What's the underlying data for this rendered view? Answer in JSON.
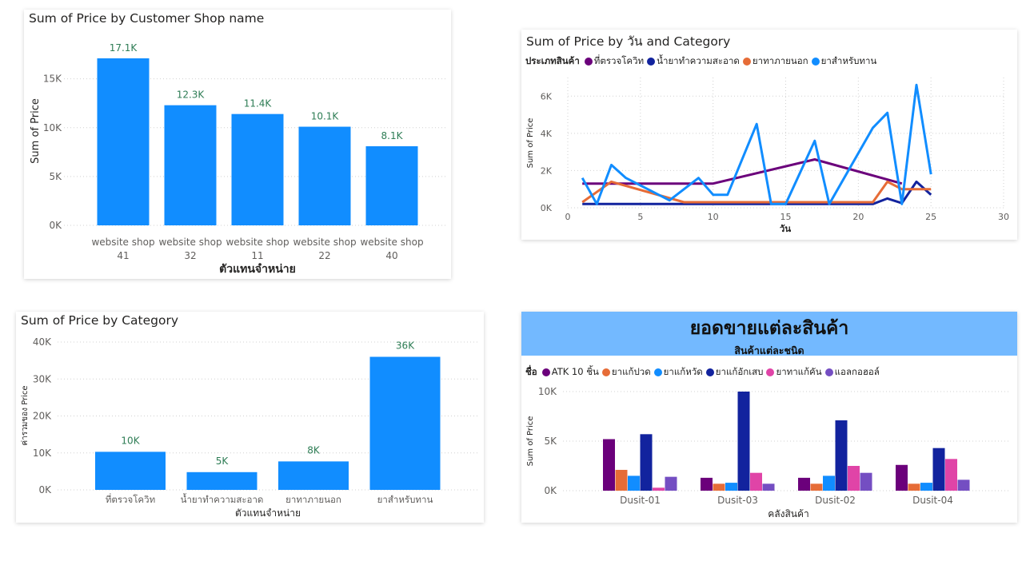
{
  "colors": {
    "bar": "#118dff",
    "label_green": "#2e7d55",
    "grid": "#d0d0d0",
    "axis_text": "#605e5c"
  },
  "charts": {
    "shop": {
      "title": "Sum of Price by Customer Shop name",
      "xlabel": "ตัวแทนจำหน่าย",
      "ylabel": "Sum of Price"
    },
    "day": {
      "title": "Sum of Price by วัน and Category",
      "legend_title": "ประเภทสินค้า",
      "xlabel": "วัน",
      "ylabel": "Sum of Price"
    },
    "category": {
      "title": "Sum of Price by Category",
      "xlabel": "ตัวแทนจำหน่าย",
      "ylabel": "ค่ารวมของ Price"
    },
    "warehouse": {
      "banner_title": "ยอดขายแต่ละสินค้า",
      "banner_subtitle": "สินค้าแต่ละชนิด",
      "legend_title": "ชื่อ",
      "xlabel": "คลังสินค้า",
      "ylabel": "Sum of Price"
    }
  },
  "chart_data": [
    {
      "type": "bar",
      "title": "Sum of Price by Customer Shop name",
      "xlabel": "ตัวแทนจำหน่าย",
      "ylabel": "Sum of Price",
      "categories": [
        [
          "website shop",
          "41"
        ],
        [
          "website shop",
          "32"
        ],
        [
          "website shop",
          "11"
        ],
        [
          "website shop",
          "22"
        ],
        [
          "website shop",
          "40"
        ]
      ],
      "values": [
        17100,
        12300,
        11400,
        10100,
        8100
      ],
      "data_labels": [
        "17.1K",
        "12.3K",
        "11.4K",
        "10.1K",
        "8.1K"
      ],
      "yticks": [
        0,
        5000,
        10000,
        15000
      ],
      "ytick_labels": [
        "0K",
        "5K",
        "10K",
        "15K"
      ],
      "ylim": [
        0,
        18000
      ],
      "grid": true
    },
    {
      "type": "line",
      "title": "Sum of Price by วัน and Category",
      "xlabel": "วัน",
      "ylabel": "Sum of Price",
      "xlim": [
        0,
        30
      ],
      "xticks": [
        0,
        5,
        10,
        15,
        20,
        25,
        30
      ],
      "ylim": [
        0,
        7000
      ],
      "yticks": [
        0,
        2000,
        4000,
        6000
      ],
      "ytick_labels": [
        "0K",
        "2K",
        "4K",
        "6K"
      ],
      "legend_position": "top-left",
      "grid": true,
      "series": [
        {
          "name": "ที่ตรวจโควิท",
          "color": "#6b007b",
          "points": [
            [
              1,
              1300
            ],
            [
              10,
              1300
            ],
            [
              17,
              2600
            ],
            [
              23,
              1300
            ]
          ]
        },
        {
          "name": "น้ำยาทำความสะอาด",
          "color": "#12239e",
          "points": [
            [
              1,
              200
            ],
            [
              21,
              200
            ],
            [
              22,
              500
            ],
            [
              23,
              250
            ],
            [
              24,
              1400
            ],
            [
              25,
              700
            ]
          ]
        },
        {
          "name": "ยาทาภายนอก",
          "color": "#e66c37",
          "points": [
            [
              1,
              300
            ],
            [
              3,
              1400
            ],
            [
              8,
              300
            ],
            [
              21,
              300
            ],
            [
              22,
              1400
            ],
            [
              23,
              1000
            ],
            [
              25,
              1000
            ]
          ]
        },
        {
          "name": "ยาสำหรับทาน",
          "color": "#118dff",
          "points": [
            [
              1,
              1600
            ],
            [
              2,
              200
            ],
            [
              3,
              2300
            ],
            [
              4,
              1600
            ],
            [
              7,
              400
            ],
            [
              9,
              1600
            ],
            [
              10,
              700
            ],
            [
              11,
              700
            ],
            [
              13,
              4500
            ],
            [
              14,
              200
            ],
            [
              15,
              200
            ],
            [
              17,
              3600
            ],
            [
              18,
              200
            ],
            [
              21,
              4300
            ],
            [
              22,
              5100
            ],
            [
              23,
              200
            ],
            [
              24,
              6600
            ],
            [
              25,
              1800
            ]
          ]
        }
      ]
    },
    {
      "type": "bar",
      "title": "Sum of Price by Category",
      "xlabel": "ตัวแทนจำหน่าย",
      "ylabel": "ค่ารวมของ Price",
      "categories": [
        "ที่ตรวจโควิท",
        "น้ำยาทำความสะอาด",
        "ยาทาภายนอก",
        "ยาสำหรับทาน"
      ],
      "values": [
        10300,
        4800,
        7700,
        36000
      ],
      "data_labels": [
        "10K",
        "5K",
        "8K",
        "36K"
      ],
      "yticks": [
        0,
        10000,
        20000,
        30000,
        40000
      ],
      "ytick_labels": [
        "0K",
        "10K",
        "20K",
        "30K",
        "40K"
      ],
      "ylim": [
        0,
        40000
      ],
      "grid": true
    },
    {
      "type": "bar",
      "title": "ยอดขายแต่ละสินค้า",
      "subtitle": "สินค้าแต่ละชนิด",
      "xlabel": "คลังสินค้า",
      "ylabel": "Sum of Price",
      "legend_title": "ชื่อ",
      "legend_position": "top-left",
      "categories": [
        "Dusit-01",
        "Dusit-03",
        "Dusit-02",
        "Dusit-04"
      ],
      "yticks": [
        0,
        5000,
        10000
      ],
      "ytick_labels": [
        "0K",
        "5K",
        "10K"
      ],
      "ylim": [
        0,
        10000
      ],
      "grid": true,
      "series": [
        {
          "name": "ATK 10 ชิ้น",
          "color": "#6b007b",
          "values": [
            5200,
            1300,
            1300,
            2600
          ]
        },
        {
          "name": "ยาแก้ปวด",
          "color": "#e66c37",
          "values": [
            2100,
            700,
            700,
            700
          ]
        },
        {
          "name": "ยาแก้หวัด",
          "color": "#118dff",
          "values": [
            1500,
            800,
            1500,
            800
          ]
        },
        {
          "name": "ยาแก้อักเสบ",
          "color": "#12239e",
          "values": [
            5700,
            10000,
            7100,
            4300
          ]
        },
        {
          "name": "ยาทาแก้คัน",
          "color": "#e044a7",
          "values": [
            300,
            1800,
            2500,
            3200
          ]
        },
        {
          "name": "แอลกอฮอล์",
          "color": "#744ec2",
          "values": [
            1400,
            700,
            1800,
            1100
          ]
        }
      ]
    }
  ]
}
